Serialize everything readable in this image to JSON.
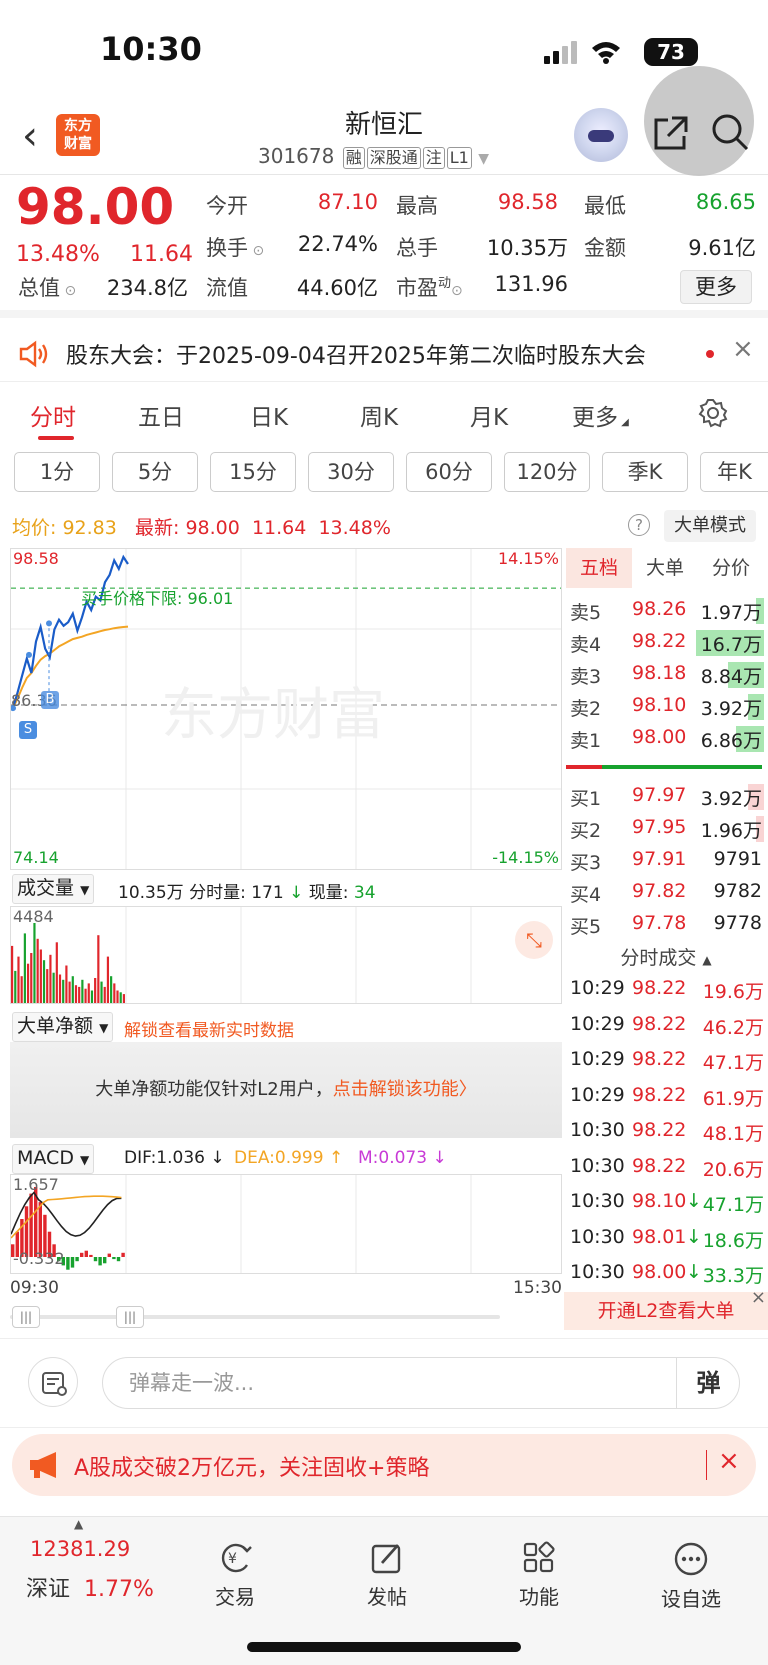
{
  "status": {
    "time": "10:30",
    "battery": "73"
  },
  "header": {
    "name": "新恒汇",
    "code": "301678",
    "tags": [
      "融",
      "深股通",
      "注",
      "L1"
    ]
  },
  "quote": {
    "price": "98.00",
    "change_pct": "13.48%",
    "change": "11.64",
    "open_label": "今开",
    "open": "87.10",
    "high_label": "最高",
    "high": "98.58",
    "low_label": "最低",
    "low": "86.65",
    "turnover_label": "换手",
    "turnover": "22.74%",
    "volume_label": "总手",
    "volume": "10.35万",
    "amount_label": "金额",
    "amount": "9.61亿",
    "mktcap_label": "总值",
    "mktcap": "234.8亿",
    "float_label": "流值",
    "float": "44.60亿",
    "pe_label": "市盈",
    "pe_sup": "动",
    "pe": "131.96",
    "more_label": "更多"
  },
  "notice": {
    "text": "股东大会：于2025-09-04召开2025年第二次临时股东大会"
  },
  "tabs": [
    "分时",
    "五日",
    "日K",
    "周K",
    "月K",
    "更多"
  ],
  "periods": [
    "1分",
    "5分",
    "15分",
    "30分",
    "60分",
    "120分",
    "季K",
    "年K"
  ],
  "info": {
    "avg_label": "均价:",
    "avg": "92.83",
    "latest_label": "最新:",
    "latest": "98.00",
    "chg": "11.64",
    "pct": "13.48%",
    "bigmode": "大单模式"
  },
  "chart_data": [
    {
      "type": "line",
      "title": "",
      "series": [
        {
          "name": "价格",
          "values": [
            86.1,
            87.4,
            88.8,
            90.2,
            89.0,
            91.6,
            92.8,
            91.0,
            90.3,
            92.6,
            93.4,
            92.9,
            93.2,
            93.9,
            92.5,
            93.6,
            94.9,
            94.2,
            95.3,
            95.0,
            96.5,
            97.1,
            98.3,
            97.6,
            98.58,
            98.0
          ]
        },
        {
          "name": "均价",
          "values": [
            86.1,
            86.9,
            87.8,
            88.6,
            89.0,
            89.6,
            90.1,
            90.4,
            90.6,
            90.9,
            91.2,
            91.4,
            91.6,
            91.8,
            91.9,
            92.0,
            92.15,
            92.25,
            92.35,
            92.45,
            92.55,
            92.62,
            92.7,
            92.76,
            92.8,
            92.83
          ]
        }
      ],
      "ylim": [
        74.14,
        98.58
      ],
      "price_top": "98.58",
      "price_bottom": "74.14",
      "pct_top": "14.15%",
      "pct_bottom": "-14.15%",
      "prev_close": "86.36",
      "limit_label": "买手价格下限:",
      "limit_value": "96.01",
      "limit": 96.01,
      "sell_marker": "S",
      "buy_marker": "B",
      "watermark": "东方财富",
      "time_start": "09:30",
      "time_end": "15:30"
    },
    {
      "type": "bar",
      "title": "成交量",
      "ymax_label": "4484",
      "values": [
        3200,
        1800,
        2600,
        1500,
        3900,
        2200,
        2800,
        4484,
        3600,
        3000,
        2400,
        1900,
        2700,
        1700,
        3400,
        1600,
        1300,
        2100,
        1200,
        1500,
        1000,
        900,
        1300,
        800,
        1100,
        700,
        1400,
        3800,
        1200,
        900,
        2600,
        1500,
        1100,
        700,
        600,
        500
      ],
      "colors_pattern": "mixed"
    },
    {
      "type": "bar",
      "title": "MACD",
      "top_label": "1.657",
      "bottom_label": "-0.332",
      "dif": "DIF:1.036",
      "dea": "DEA:0.999",
      "m": "M:0.073",
      "values": [
        0.3,
        0.6,
        0.9,
        1.2,
        1.5,
        1.657,
        1.3,
        1.0,
        0.6,
        0.3,
        -0.1,
        -0.2,
        -0.3,
        -0.25,
        -0.1,
        0.1,
        0.15,
        0.05,
        -0.1,
        -0.2,
        -0.15,
        0.08,
        -0.05,
        -0.1,
        0.1
      ]
    }
  ],
  "vol_header": {
    "label": "成交量",
    "total": "10.35万",
    "fenshi_label": "分时量:",
    "fenshi": "171",
    "now_label": "现量:",
    "now": "34"
  },
  "bigorder": {
    "label": "大单净额",
    "unlock": "解锁查看最新实时数据",
    "msg": "大单净额功能仅针对L2用户，",
    "link": "点击解锁该功能"
  },
  "orderbook": {
    "tabs": [
      "五档",
      "大单",
      "分价"
    ],
    "asks": [
      {
        "label": "卖5",
        "price": "98.26",
        "vol": "1.97万",
        "frac": 0.12
      },
      {
        "label": "卖4",
        "price": "98.22",
        "vol": "16.7万",
        "frac": 1.0
      },
      {
        "label": "卖3",
        "price": "98.18",
        "vol": "8.84万",
        "frac": 0.53
      },
      {
        "label": "卖2",
        "price": "98.10",
        "vol": "3.92万",
        "frac": 0.23
      },
      {
        "label": "卖1",
        "price": "98.00",
        "vol": "6.86万",
        "frac": 0.41
      }
    ],
    "bids": [
      {
        "label": "买1",
        "price": "97.97",
        "vol": "3.92万",
        "frac": 0.23
      },
      {
        "label": "买2",
        "price": "97.95",
        "vol": "1.96万",
        "frac": 0.12
      },
      {
        "label": "买3",
        "price": "97.91",
        "vol": "9791",
        "frac": 0
      },
      {
        "label": "买4",
        "price": "97.82",
        "vol": "9782",
        "frac": 0
      },
      {
        "label": "买5",
        "price": "97.78",
        "vol": "9778",
        "frac": 0
      }
    ],
    "trade_header": "分时成交",
    "trades": [
      {
        "time": "10:29",
        "price": "98.22",
        "vol": "19.6万",
        "dir": ""
      },
      {
        "time": "10:29",
        "price": "98.22",
        "vol": "46.2万",
        "dir": ""
      },
      {
        "time": "10:29",
        "price": "98.22",
        "vol": "47.1万",
        "dir": ""
      },
      {
        "time": "10:29",
        "price": "98.22",
        "vol": "61.9万",
        "dir": ""
      },
      {
        "time": "10:30",
        "price": "98.22",
        "vol": "48.1万",
        "dir": ""
      },
      {
        "time": "10:30",
        "price": "98.22",
        "vol": "20.6万",
        "dir": ""
      },
      {
        "time": "10:30",
        "price": "98.10",
        "vol": "47.1万",
        "dir": "↓"
      },
      {
        "time": "10:30",
        "price": "98.01",
        "vol": "18.6万",
        "dir": "↓"
      },
      {
        "time": "10:30",
        "price": "98.00",
        "vol": "33.3万",
        "dir": "↓"
      }
    ],
    "open_l2": "开通L2查看大单"
  },
  "danmu": {
    "placeholder": "弹幕走一波...",
    "button": "弹"
  },
  "banner": {
    "text": "A股成交破2万亿元，关注固收+策略"
  },
  "bottom": {
    "index_value": "12381.29",
    "index_name": "深证",
    "index_pct": "1.77%",
    "items": [
      "交易",
      "发帖",
      "功能",
      "设自选"
    ]
  },
  "colors": {
    "up": "#e0262c",
    "down": "#17a22e",
    "avg": "#f3a524",
    "brand": "#f15a22"
  }
}
